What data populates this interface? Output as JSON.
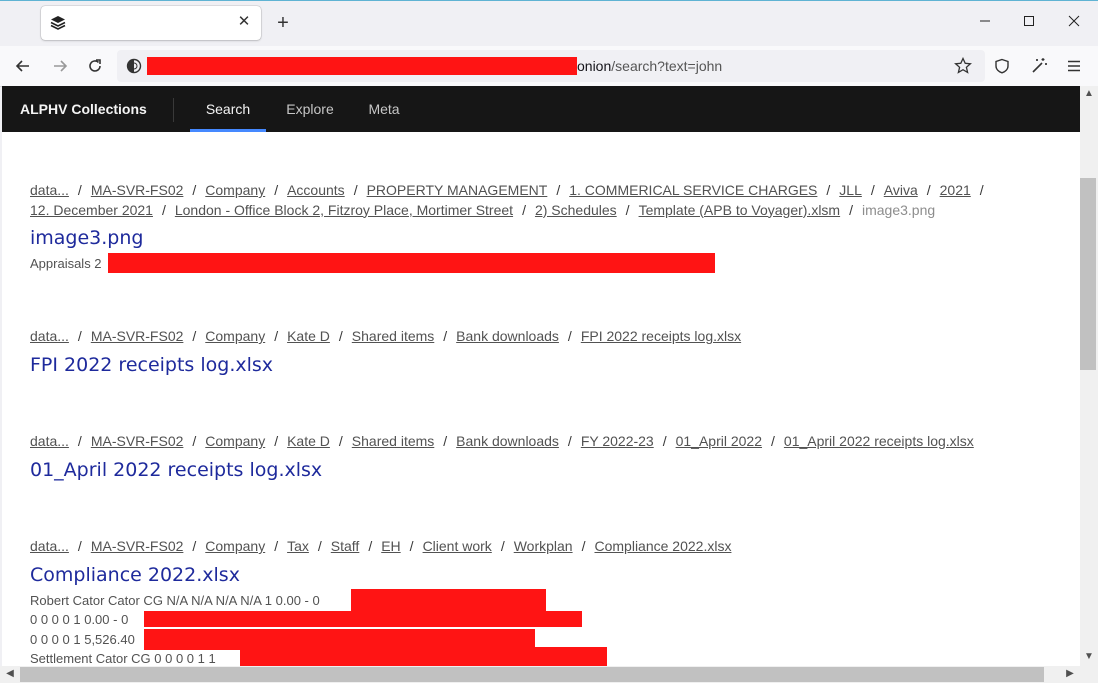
{
  "browser": {
    "tab_title": "",
    "url_visible": "onion",
    "url_path": "/search?text=john",
    "new_tab": "+",
    "close_tab": "✕"
  },
  "site": {
    "brand": "ALPHV Collections",
    "nav": [
      "Search",
      "Explore",
      "Meta"
    ],
    "active_nav": "Search"
  },
  "results": [
    {
      "crumbs": [
        "data...",
        "MA-SVR-FS02",
        "Company",
        "Accounts",
        "PROPERTY MANAGEMENT",
        "1. COMMERICAL SERVICE CHARGES",
        "JLL",
        "Aviva",
        "2021",
        "12. December 2021",
        "London - Office Block 2, Fitzroy Place, Mortimer Street",
        "2) Schedules",
        "Template (APB to Voyager).xlsm"
      ],
      "current": "image3.png",
      "title": "image3.png",
      "snippets": [
        "Appraisals 2"
      ]
    },
    {
      "crumbs": [
        "data...",
        "MA-SVR-FS02",
        "Company",
        "Kate D",
        "Shared items",
        "Bank downloads",
        "FPI 2022 receipts log.xlsx"
      ],
      "current": "",
      "title": "FPI 2022 receipts log.xlsx",
      "snippets": []
    },
    {
      "crumbs": [
        "data...",
        "MA-SVR-FS02",
        "Company",
        "Kate D",
        "Shared items",
        "Bank downloads",
        "FY 2022-23",
        "01_April 2022",
        "01_April 2022 receipts log.xlsx"
      ],
      "current": "",
      "title": "01_April 2022 receipts log.xlsx",
      "snippets": []
    },
    {
      "crumbs": [
        "data...",
        "MA-SVR-FS02",
        "Company",
        "Tax",
        "Staff",
        "EH",
        "Client work",
        "Workplan",
        "Compliance 2022.xlsx"
      ],
      "current": "",
      "title": "Compliance 2022.xlsx",
      "snippets": [
        "Robert Cator Cator CG N/A N/A N/A N/A 1 0.00 - 0",
        "0 0 0 0 1 0.00 - 0",
        "0 0 0 0 1 5,526.40",
        "Settlement Cator CG 0 0 0 0 1 1"
      ]
    }
  ],
  "colors": {
    "redaction": "#ff1414",
    "header_bg": "#161616",
    "title_link": "#1e2a9c",
    "active_tab_underline": "#4589ff"
  }
}
